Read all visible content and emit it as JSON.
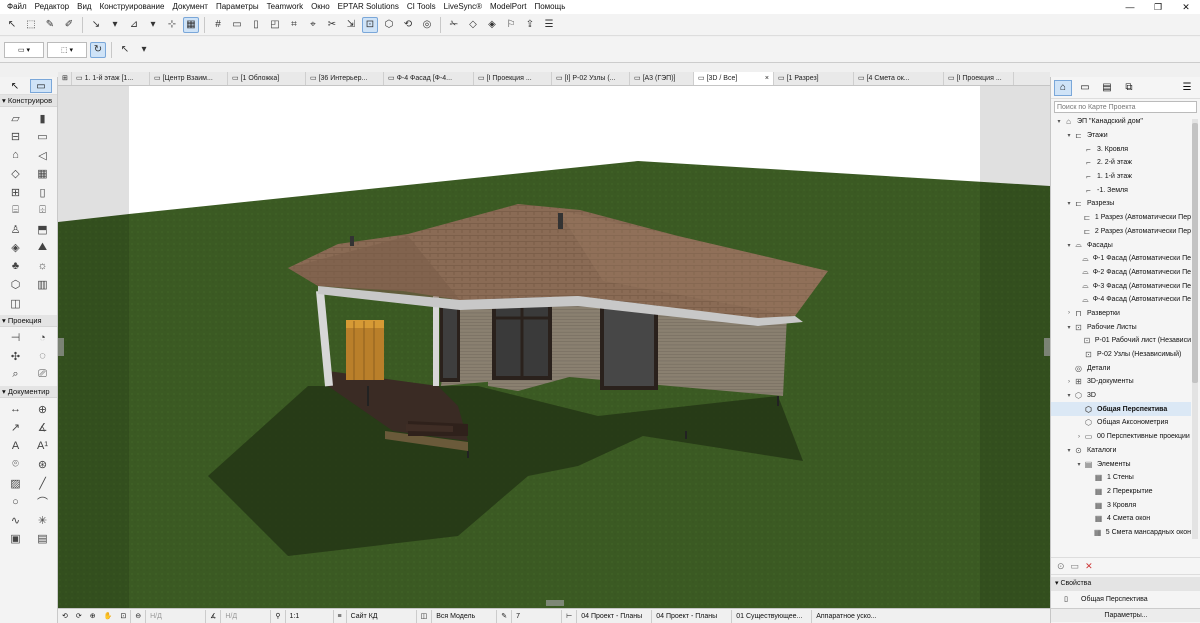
{
  "menubar": {
    "items": [
      "Файл",
      "Редактор",
      "Вид",
      "Конструирование",
      "Документ",
      "Параметры",
      "Teamwork",
      "Окно",
      "EPTAR Solutions",
      "CI Tools",
      "LiveSync®",
      "ModelPort",
      "Помощь"
    ],
    "window_controls": [
      "—",
      "❐",
      "✕"
    ]
  },
  "toolbox": {
    "sections": [
      "Конструиров",
      "Проекция",
      "Документир"
    ]
  },
  "tabs": [
    {
      "label": "1. 1-й этаж [1...",
      "icon": "floor-plan-icon"
    },
    {
      "label": "[Центр Взаим...",
      "icon": "layout-icon"
    },
    {
      "label": "[1 Обложка]",
      "icon": "layout-icon"
    },
    {
      "label": "[36 Интерьер...",
      "icon": "layout-icon"
    },
    {
      "label": "Ф-4 Фасад [Ф-4...",
      "icon": "elevation-icon"
    },
    {
      "label": "[I Проекция ...",
      "icon": "layout-icon"
    },
    {
      "label": "[I] Р-02 Узлы (...",
      "icon": "worksheet-icon"
    },
    {
      "label": "[А3 (ГЭП)]",
      "icon": "layout-icon"
    },
    {
      "label": "[3D / Все]",
      "icon": "3d-icon",
      "close": "×"
    },
    {
      "label": "[1 Разрез]",
      "icon": "section-icon"
    },
    {
      "label": "[4 Смета ок...",
      "icon": "schedule-icon"
    },
    {
      "label": "[I Проекция ...",
      "icon": "layout-icon"
    }
  ],
  "navigator": {
    "search_placeholder": "Поиск по Карте Проекта",
    "tree": [
      {
        "label": "ЭП \"Канадский дом\"",
        "indent": 0,
        "toggle": "▾",
        "icon": "house-icon"
      },
      {
        "label": "Этажи",
        "indent": 1,
        "toggle": "▾",
        "icon": "stories-icon"
      },
      {
        "label": "3. Кровля",
        "indent": 2,
        "toggle": "",
        "icon": "story-icon"
      },
      {
        "label": "2. 2-й этаж",
        "indent": 2,
        "toggle": "",
        "icon": "story-icon"
      },
      {
        "label": "1. 1-й этаж",
        "indent": 2,
        "toggle": "",
        "icon": "story-icon"
      },
      {
        "label": "-1. Земля",
        "indent": 2,
        "toggle": "",
        "icon": "story-icon"
      },
      {
        "label": "Разрезы",
        "indent": 1,
        "toggle": "▾",
        "icon": "sections-icon"
      },
      {
        "label": "1 Разрез (Автоматически Пер",
        "indent": 2,
        "toggle": "",
        "icon": "section-icon"
      },
      {
        "label": "2 Разрез (Автоматически Пер",
        "indent": 2,
        "toggle": "",
        "icon": "section-icon"
      },
      {
        "label": "Фасады",
        "indent": 1,
        "toggle": "▾",
        "icon": "elevations-icon"
      },
      {
        "label": "Ф-1 Фасад (Автоматически Пе",
        "indent": 2,
        "toggle": "",
        "icon": "elevation-icon"
      },
      {
        "label": "Ф-2 Фасад (Автоматически Пе",
        "indent": 2,
        "toggle": "",
        "icon": "elevation-icon"
      },
      {
        "label": "Ф-3 Фасад (Автоматически Пе",
        "indent": 2,
        "toggle": "",
        "icon": "elevation-icon"
      },
      {
        "label": "Ф-4 Фасад (Автоматически Пе",
        "indent": 2,
        "toggle": "",
        "icon": "elevation-icon"
      },
      {
        "label": "Развертки",
        "indent": 1,
        "toggle": "›",
        "icon": "interior-elevations-icon"
      },
      {
        "label": "Рабочие Листы",
        "indent": 1,
        "toggle": "▾",
        "icon": "worksheets-icon"
      },
      {
        "label": "Р-01 Рабочий лист (Независи",
        "indent": 2,
        "toggle": "",
        "icon": "worksheet-icon"
      },
      {
        "label": "Р-02 Узлы (Независимый)",
        "indent": 2,
        "toggle": "",
        "icon": "worksheet-icon"
      },
      {
        "label": "Детали",
        "indent": 1,
        "toggle": "",
        "icon": "details-icon"
      },
      {
        "label": "3D-документы",
        "indent": 1,
        "toggle": "›",
        "icon": "3d-documents-icon"
      },
      {
        "label": "3D",
        "indent": 1,
        "toggle": "▾",
        "icon": "3d-icon"
      },
      {
        "label": "Общая Перспектива",
        "indent": 2,
        "toggle": "",
        "icon": "perspective-icon",
        "selected": true
      },
      {
        "label": "Общая Аксонометрия",
        "indent": 2,
        "toggle": "",
        "icon": "axonometry-icon"
      },
      {
        "label": "00 Перспективные проекции",
        "indent": 2,
        "toggle": "›",
        "icon": "folder-icon"
      },
      {
        "label": "Каталоги",
        "indent": 1,
        "toggle": "▾",
        "icon": "schedules-icon"
      },
      {
        "label": "Элементы",
        "indent": 2,
        "toggle": "▾",
        "icon": "elements-icon"
      },
      {
        "label": "1 Стены",
        "indent": 3,
        "toggle": "",
        "icon": "schedule-icon"
      },
      {
        "label": "2 Перекрытие",
        "indent": 3,
        "toggle": "",
        "icon": "schedule-icon"
      },
      {
        "label": "3 Кровля",
        "indent": 3,
        "toggle": "",
        "icon": "schedule-icon"
      },
      {
        "label": "4 Смета окон",
        "indent": 3,
        "toggle": "",
        "icon": "schedule-icon"
      },
      {
        "label": "5 Смета мансардных окон",
        "indent": 3,
        "toggle": "",
        "icon": "schedule-icon"
      }
    ],
    "properties_title": "Свойства",
    "properties_view": "Общая Перспектива",
    "parameters_button": "Параметры..."
  },
  "navbar": {
    "undo": "Н/Д",
    "zoom": "Н/Д",
    "scale": "1:1",
    "layer_combo": "Сайт КД",
    "model_view": "Вся Модель",
    "pen_set": "7",
    "dim1": "04 Проект - Планы",
    "dim2": "04 Проект - Планы",
    "renovation": "01 Существующее...",
    "engine": "Аппаратное уско..."
  }
}
